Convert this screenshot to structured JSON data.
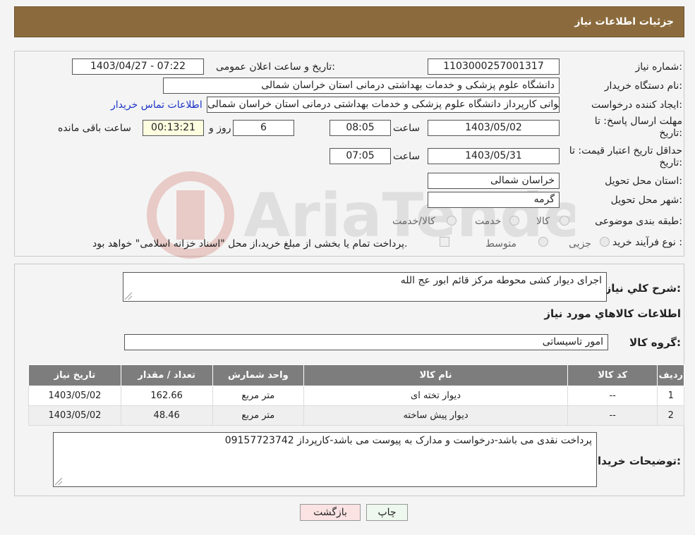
{
  "header": {
    "title": "جزئیات اطلاعات نیاز"
  },
  "fields": {
    "need_number_label": "شماره نیاز:",
    "need_number": "1103000257001317",
    "announce_label": "تاریخ و ساعت اعلان عمومی:",
    "announce_value": "1403/04/27 - 07:22",
    "buyer_org_label": "نام دستگاه خریدار:",
    "buyer_org": "دانشگاه علوم پزشکی و خدمات بهداشتی درمانی استان خراسان شمالی",
    "requester_label": "ایجاد کننده درخواست:",
    "requester": "محمد پوررضوانی کارپرداز دانشگاه علوم پزشکی و خدمات بهداشتی درمانی استان خراسان شمالی",
    "contact_link": "اطلاعات تماس خریدار",
    "deadline_label_1": "مهلت ارسال پاسخ: تا",
    "deadline_label_2": "تاریخ:",
    "deadline_date": "1403/05/02",
    "time_label": "ساعت",
    "deadline_time": "08:05",
    "days_value": "6",
    "days_label": "روز و",
    "remaining_time": "00:13:21",
    "remaining_label": "ساعت باقی مانده",
    "validity_label_1": "حداقل تاریخ اعتبار قیمت: تا",
    "validity_label_2": "تاریخ:",
    "validity_date": "1403/05/31",
    "validity_time": "07:05",
    "province_label": "استان محل تحویل:",
    "province": "خراسان شمالی",
    "city_label": "شهر محل تحویل:",
    "city": "گرمه",
    "category_label": "طبقه بندی موضوعی:",
    "category_options": [
      "کالا",
      "خدمت",
      "کالا/خدمت"
    ],
    "purchase_label": "نوع فرآیند خرید :",
    "purchase_options": [
      "جزیی",
      "متوسط"
    ],
    "payment_note": "پرداخت تمام یا بخشی از مبلغ خرید،از محل \"اسناد خزانه اسلامی\" خواهد بود."
  },
  "summary": {
    "label": "شرح کلي نیاز:",
    "value": "اجرای دیوار کشی محوطه مرکز قائم ابور عج الله",
    "items_title": "اطلاعات کالاهاي مورد نیاز",
    "group_label": "گروه کالا:",
    "group_value": "امور تاسیساتی"
  },
  "table": {
    "headers": [
      "ردیف",
      "کد کالا",
      "نام کالا",
      "واحد شمارش",
      "تعداد / مقدار",
      "تاریخ نیاز"
    ],
    "rows": [
      [
        "1",
        "--",
        "دیوار تخته ای",
        "متر مربع",
        "162.66",
        "1403/05/02"
      ],
      [
        "2",
        "--",
        "دیوار پیش ساخته",
        "متر مربع",
        "48.46",
        "1403/05/02"
      ]
    ]
  },
  "notes": {
    "label": "توضیحات خریدار:",
    "value": "پرداخت نقدی می باشد-درخواست و مدارک به پیوست می باشد-کارپرداز 09157723742"
  },
  "buttons": {
    "print": "چاپ",
    "back": "بازگشت"
  },
  "watermark_text": "AriaTender.neT",
  "colors": {
    "header": "#8b6b3d",
    "link": "#1a33c8",
    "table_header": "#7d7d7d"
  }
}
